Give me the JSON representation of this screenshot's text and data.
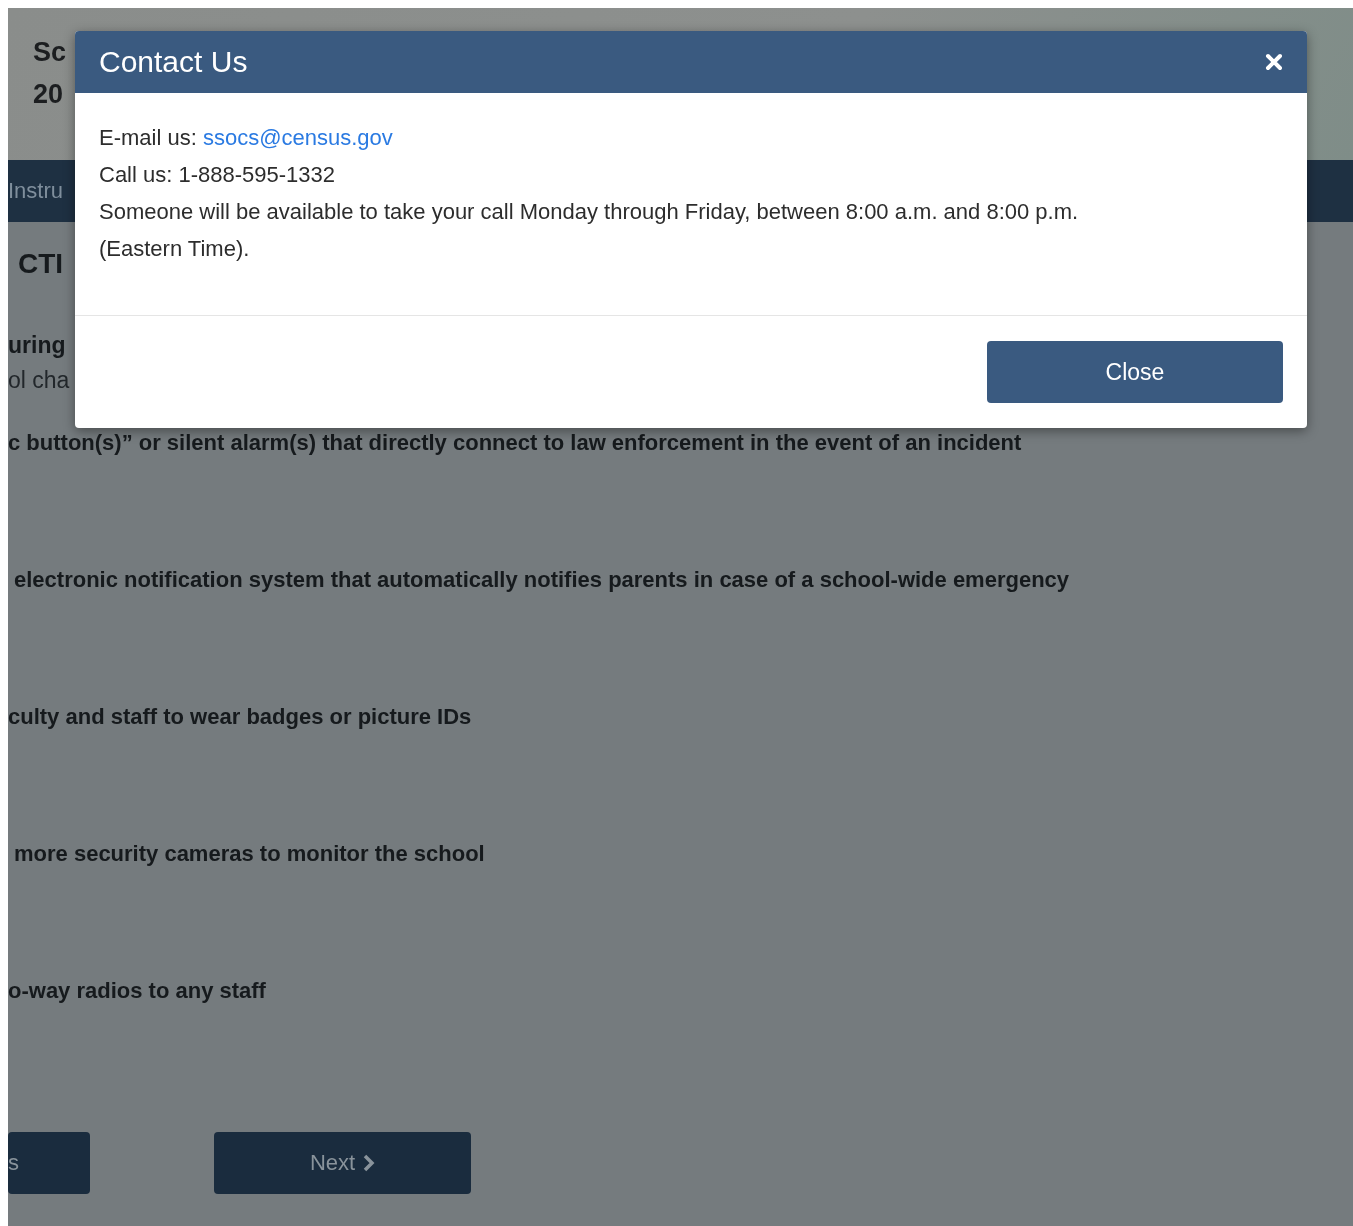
{
  "page": {
    "title_lines": [
      "Sc",
      "20"
    ],
    "nav_item": "Instru",
    "section_heading": "CTI",
    "intro_heading": "uring",
    "intro_text": "ol cha",
    "questions": [
      "c button(s)” or silent alarm(s) that directly connect to law enforcement in the event of an incident",
      "electronic notification system that automatically notifies parents in case of a school-wide emergency",
      "culty and staff to wear badges or picture IDs",
      "more security cameras to monitor the school",
      "o-way radios to any staff"
    ],
    "buttons": [
      {
        "label": "s",
        "kind": "back"
      },
      {
        "label": "Next",
        "kind": "next"
      }
    ]
  },
  "dialog": {
    "title": "Contact Us",
    "email_label": "E-mail us:",
    "email": "ssocs@census.gov",
    "phone_line": "Call us: 1-888-595-1332",
    "hours": "Someone will be available to take your call Monday through Friday, between 8:00 a.m. and 8:00 p.m. (Eastern Time).",
    "close_button": "Close"
  }
}
